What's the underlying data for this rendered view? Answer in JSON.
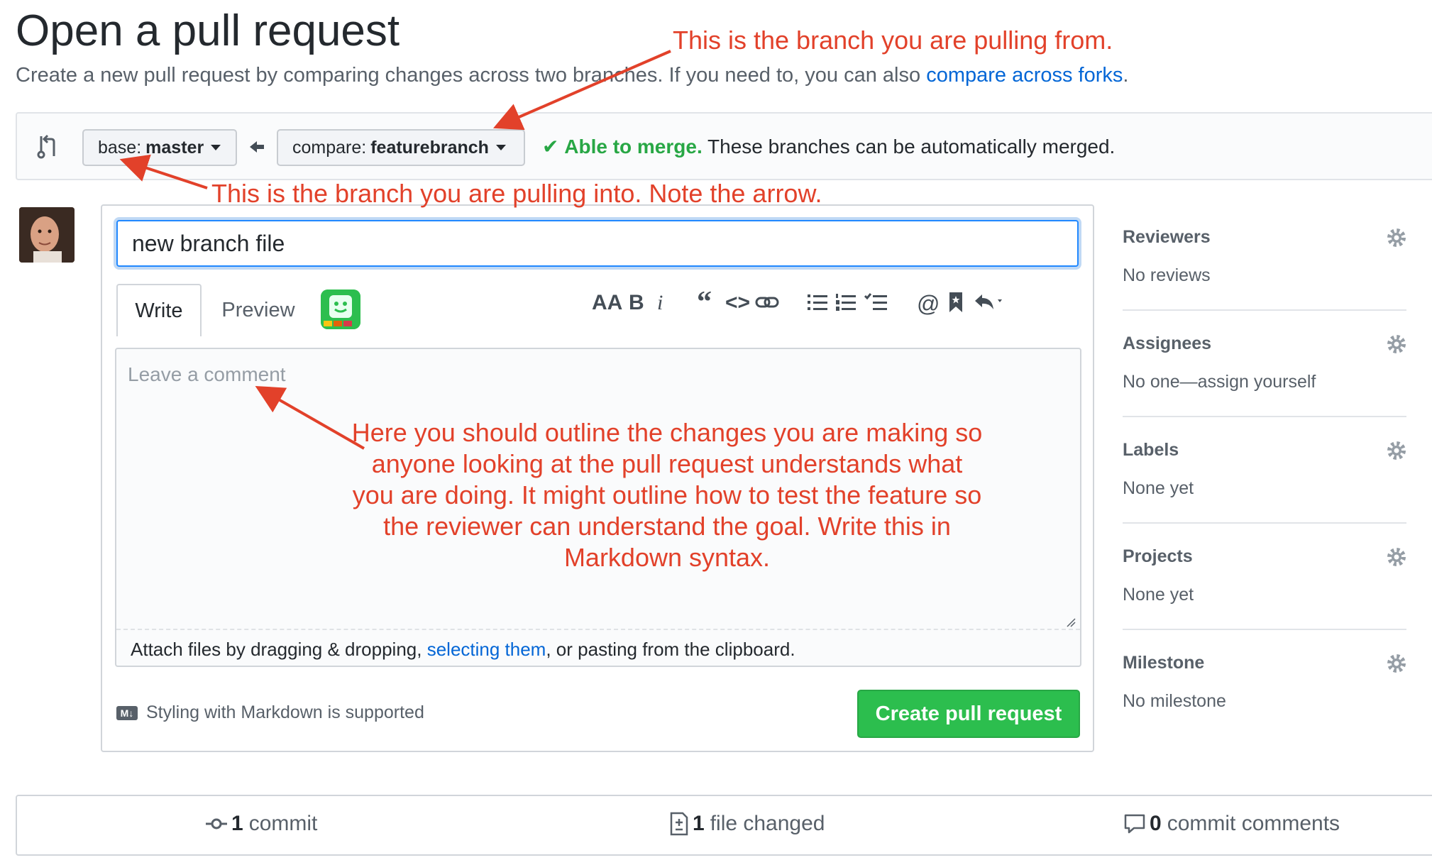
{
  "header": {
    "title": "Open a pull request",
    "subtitle_prefix": "Create a new pull request by comparing changes across two branches. If you need to, you can also ",
    "subtitle_link": "compare across forks",
    "subtitle_suffix": "."
  },
  "range": {
    "base_label": "base:",
    "base_value": "master",
    "compare_label": "compare:",
    "compare_value": "featurebranch",
    "merge_ok": "Able to merge.",
    "merge_text": "These branches can be automatically merged."
  },
  "composer": {
    "title_value": "new branch file",
    "tab_write": "Write",
    "tab_preview": "Preview",
    "toolbar": [
      "AA",
      "B",
      "i",
      "“",
      "<>",
      "link",
      "list",
      "ordered-list",
      "task-list",
      "@",
      "bookmark",
      "reply"
    ],
    "comment_placeholder": "Leave a comment",
    "attach_prefix": "Attach files by dragging & dropping, ",
    "attach_link": "selecting them",
    "attach_suffix": ", or pasting from the clipboard.",
    "markdown_icon": "M↓",
    "markdown_note": "Styling with Markdown is supported",
    "create_button": "Create pull request"
  },
  "sidebar": [
    {
      "heading": "Reviewers",
      "value": "No reviews"
    },
    {
      "heading": "Assignees",
      "value": "No one—assign yourself"
    },
    {
      "heading": "Labels",
      "value": "None yet"
    },
    {
      "heading": "Projects",
      "value": "None yet"
    },
    {
      "heading": "Milestone",
      "value": "No milestone"
    }
  ],
  "stats": {
    "commits_count": "1",
    "commits_label": "commit",
    "files_count": "1",
    "files_label": "file changed",
    "comments_count": "0",
    "comments_label": "commit comments"
  },
  "annotations": {
    "compare_note": "This is the branch you are pulling from.",
    "base_note": "This is the branch you are pulling into. Note the arrow.",
    "body_note": "Here you should outline the changes you are making so anyone looking at the pull request understands what you are doing. It might outline how to test the feature so the reviewer can understand the goal. Write this in Markdown syntax."
  },
  "colors": {
    "annotation": "#e2412a",
    "success": "#28a745",
    "link": "#0366d6",
    "button": "#2cbe4e"
  },
  "icons": [
    "git-compare-icon",
    "arrow-left-icon",
    "check-icon",
    "gear-icon",
    "commit-icon",
    "file-diff-icon",
    "comment-icon",
    "markdown-icon",
    "bot-icon"
  ]
}
